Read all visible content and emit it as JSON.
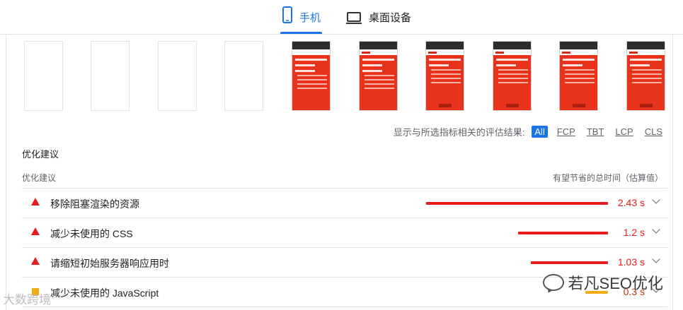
{
  "tabs": [
    {
      "label": "手机",
      "icon": "mobile-icon",
      "active": true
    },
    {
      "label": "桌面设备",
      "icon": "desktop-icon",
      "active": false
    }
  ],
  "filmstrip_page_title": "Custom Lithium Battery Pack Manufacturer",
  "filter": {
    "label": "显示与所选指标相关的评估结果:",
    "chips": [
      "All",
      "FCP",
      "TBT",
      "LCP",
      "CLS"
    ],
    "active": "All"
  },
  "section_title": "优化建议",
  "table": {
    "col_left": "优化建议",
    "col_right": "有望节省的总时间（估算值）",
    "rows": [
      {
        "name": "移除阻塞渲染的资源",
        "value": "2.43 s",
        "severity": "fail",
        "saving_seconds": 2.43
      },
      {
        "name": "减少未使用的 CSS",
        "value": "1.2 s",
        "severity": "fail",
        "saving_seconds": 1.2
      },
      {
        "name": "请缩短初始服务器响应用时",
        "value": "1.03 s",
        "severity": "fail",
        "saving_seconds": 1.03
      },
      {
        "name": "减少未使用的 JavaScript",
        "value": "0.3 s",
        "severity": "average",
        "saving_seconds": 0.3
      }
    ]
  },
  "colors": {
    "accent": "#1a73e8",
    "fail": "#e61b1b",
    "average": "#f0ad16"
  },
  "watermark": {
    "right": "若凡SEO优化",
    "left": "大数跨境"
  }
}
